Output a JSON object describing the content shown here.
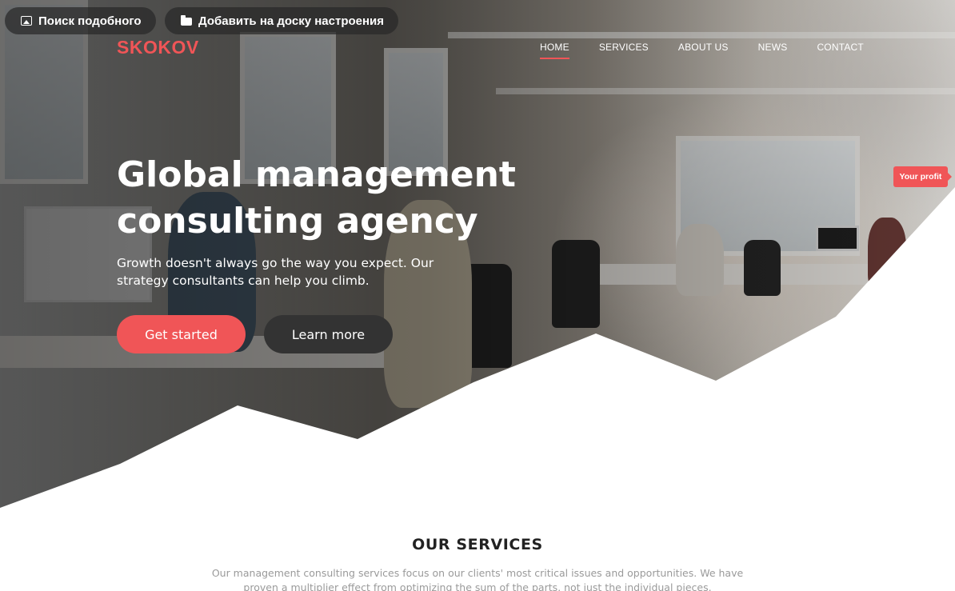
{
  "overlay_buttons": {
    "similar_search": {
      "label": "Поиск подобного",
      "icon": "image-icon"
    },
    "add_to_board": {
      "label": "Добавить на доску настроения",
      "icon": "folder-icon"
    }
  },
  "header": {
    "logo": "SKOKOV",
    "nav": [
      {
        "label": "HOME",
        "active": true
      },
      {
        "label": "SERVICES",
        "active": false
      },
      {
        "label": "ABOUT US",
        "active": false
      },
      {
        "label": "NEWS",
        "active": false
      },
      {
        "label": "CONTACT",
        "active": false
      }
    ]
  },
  "hero": {
    "title_line1": "Global management",
    "title_line2": "consulting agency",
    "subtitle": "Growth doesn't always go the way you expect. Our strategy consultants can help you climb.",
    "primary_button": "Get started",
    "secondary_button": "Learn more",
    "profit_tag": "Your profit"
  },
  "services": {
    "title": "OUR SERVICES",
    "description": "Our management consulting services focus on our clients' most critical issues and opportunities. We have proven a multiplier effect from optimizing the sum of the parts, not just the individual pieces."
  },
  "colors": {
    "accent": "#f05557",
    "dark_button": "#333333",
    "text_dark": "#222222",
    "text_muted": "#9a9a9a"
  }
}
